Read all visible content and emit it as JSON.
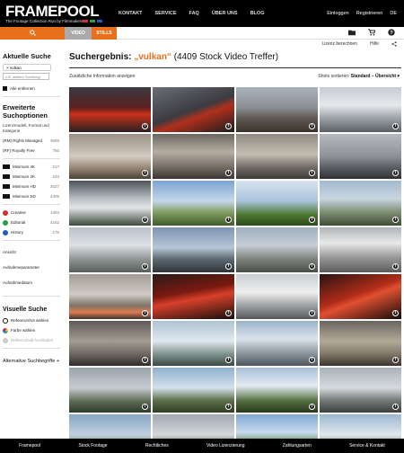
{
  "brand": {
    "logo": "FRAMEPOOL",
    "tagline": "The Footage Collection Run by Filmmakers",
    "dot_colors": [
      "#d32f2f",
      "#2e9e44",
      "#1e5bc6"
    ]
  },
  "main_nav": [
    "KONTAKT",
    "SERVICE",
    "FAQ",
    "ÜBER UNS",
    "BLOG"
  ],
  "account_nav": [
    "Einloggen",
    "Registrieren",
    "DE"
  ],
  "tabs": {
    "video": "VIDEO",
    "stills": "STILLS"
  },
  "sublinks": [
    "Lizenz berechnen",
    "Hilfe"
  ],
  "sidebar": {
    "current_search_heading": "Aktuelle Suche",
    "active_tag": "vulkan",
    "search_placeholder": "z.B. weitere Suchbegr",
    "remove_all": "Alle entfernen",
    "extended_heading": "Erweiterte Suchoptionen",
    "license_intro": "Lizenzmodell, Format und Kategorie",
    "license": [
      {
        "label": "(RM) Rights Managed",
        "count": "3669"
      },
      {
        "label": "(RF) Royalty Free",
        "count": "750"
      }
    ],
    "formats": [
      {
        "label": "Minimum 4K",
        "count": "217"
      },
      {
        "label": "Minimum 2K",
        "count": "223"
      },
      {
        "label": "Minimum HD",
        "count": "3027"
      },
      {
        "label": "Minimum SD",
        "count": "4409"
      }
    ],
    "categories": [
      {
        "label": "Creative",
        "count": "1353",
        "color": "#d32f2f"
      },
      {
        "label": "Editorial",
        "count": "4162",
        "color": "#2e9e44"
      },
      {
        "label": "History",
        "count": "178",
        "color": "#1e5bc6"
      }
    ],
    "facets": [
      "Ansicht",
      "Aufnahmeparameter",
      "Aufnahmedatum"
    ],
    "visual_heading": "Visuelle Suche",
    "visual_options": [
      "Referenzshot wählen",
      "Farbe wählen",
      "Referenzbild hochladen"
    ],
    "alt_terms": "Alternative Suchbegriffe +"
  },
  "results": {
    "title_prefix": "Suchergebnis: ",
    "query": "„vulkan“",
    "count_text": " (4409 Stock Video Treffer)",
    "additional_info": "Zusätzliche Information anzeigen",
    "sort_label": "Shots sortieren: ",
    "sort_value": "Standard – Übersicht ▾",
    "info_glyph": "i",
    "thumbnails": [
      "linear-gradient(180deg,#3a3a40 0%,#5a2020 45%,#c8301a 60%,#2a2020 100%)",
      "linear-gradient(160deg,#6b6e76 0%,#3b3b40 50%,#b0301c 62%,#1c1c1e 100%)",
      "linear-gradient(180deg,#a9b3bd 0%,#8b8f93 45%,#5d5750 70%,#3a332c 100%)",
      "linear-gradient(180deg,#c7ccd3 0%,#e6e8ea 40%,#9aa0a6 70%,#5b5f63 100%)",
      "linear-gradient(180deg,#9a8f84 0%,#d3cbbf 50%,#8b7b6a 80%,#4a4038 100%)",
      "linear-gradient(180deg,#6a6660 0%,#b5ada2 40%,#7c746b 70%,#3b3632 100%)",
      "linear-gradient(180deg,#8f8a82 0%,#c4bdb1 45%,#6f6a63 75%,#3d3a36 100%)",
      "linear-gradient(180deg,#b6b9bd 0%,#8e9296 50%,#5a5e62 75%,#2f3033 100%)",
      "linear-gradient(180deg,#4b5259 0%,#b8bec4 40%,#e2e4e6 60%,#3b4a3a 100%)",
      "linear-gradient(180deg,#7ba4d3 0%,#c5d8ea 45%,#7e9a5c 72%,#3f5c2a 100%)",
      "linear-gradient(180deg,#d7e3ee 0%,#aac4dd 45%,#4f7a33 75%,#2c4a1a 100%)",
      "linear-gradient(180deg,#a2b9cf 0%,#c9d6e1 40%,#7e8f73 70%,#3e4d33 100%)",
      "linear-gradient(180deg,#b9c1c9 0%,#dde1e5 40%,#8f9694 70%,#56605a 100%)",
      "linear-gradient(180deg,#7d95b3 0%,#b7c6d6 45%,#5f6a73 70%,#2d333a 100%)",
      "linear-gradient(180deg,#9fb0c0 0%,#c6ced6 40%,#7d837c 70%,#4a4d47 100%)",
      "linear-gradient(180deg,#b0b4b8 0%,#e9e9e9 35%,#9c9c9c 65%,#5b5b5b 100%)",
      "linear-gradient(180deg,#a19b94 0%,#d0cbc4 45%,#7c7468 70%,#e07a50 85%,#3a3330 100%)",
      "linear-gradient(170deg,#2a1a18 0%,#7a1a10 40%,#d8402a 55%,#1a0e0c 100%)",
      "linear-gradient(180deg,#c8cdd2 0%,#f0f0ee 40%,#9ea1a3 70%,#55585b 100%)",
      "linear-gradient(160deg,#2a1412 0%,#b02c18 45%,#e05030 55%,#160b0a 100%)",
      "linear-gradient(180deg,#5e5a55 0%,#a29c93 45%,#6a655e 75%,#2f2c29 100%)",
      "linear-gradient(180deg,#b0c3d3 0%,#e1e8ee 45%,#7c8f8a 75%,#3a4a46 100%)",
      "linear-gradient(180deg,#9cb3c9 0%,#dbe4ec 40%,#8f9aa2 70%,#4d565d 100%)",
      "linear-gradient(180deg,#6a6560 0%,#b2a997 45%,#857b6c 72%,#3b352f 100%)",
      "linear-gradient(180deg,#9aa3ac 0%,#c7ccd1 45%,#5c6b55 75%,#2f3a2a 100%)",
      "linear-gradient(180deg,#8fb0cf 0%,#d4e1ec 45%,#60724d 72%,#2f3f22 100%)",
      "linear-gradient(180deg,#a7c0d8 0%,#e4ecf3 40%,#526c3e 75%,#283a1c 100%)",
      "linear-gradient(180deg,#a9b2ba 0%,#d6dadd 45%,#757c79 72%,#3c413f 100%)",
      "linear-gradient(180deg,#88a6c4 0%,#bfd0df 45%,#6e8255 75%,#36461f 100%)",
      "linear-gradient(180deg,#a0a8b0 0%,#d2d6da 45%,#6b7460 72%,#333a2c 100%)",
      "linear-gradient(180deg,#7ea7cf 0%,#c8dcef 40%,#4e6f32 72%,#24391a 100%)",
      "linear-gradient(180deg,#9db7d1 0%,#e0e8ef 45%,#7f8778 72%,#3f453a 100%)"
    ]
  },
  "footer": [
    "Framepool",
    "Stock Footage",
    "Rechtliches",
    "Video Lizenzierung",
    "Zahlungsarten",
    "Service & Kontakt"
  ]
}
